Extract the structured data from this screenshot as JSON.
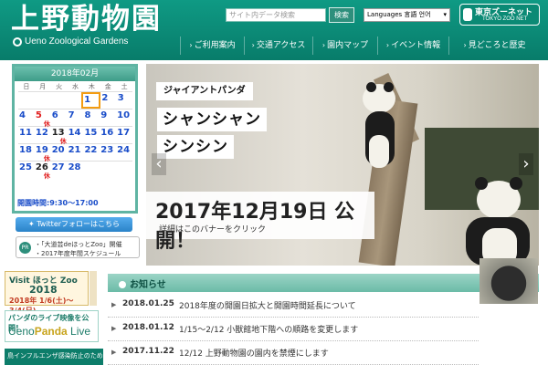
{
  "header": {
    "title": "上野動物園",
    "subtitle": "Ueno Zoological Gardens",
    "search_placeholder": "サイト内データ検索",
    "search_button": "検索",
    "language_label": "Languages 言語 언어",
    "zoonet_jp": "東京ズーネット",
    "zoonet_en": "TOKYO ZOO NET",
    "nav": [
      "ご利用案内",
      "交通アクセス",
      "園内マップ",
      "イベント情報",
      "見どころと歴史"
    ]
  },
  "calendar": {
    "title": "2018年02月",
    "dow": [
      "日",
      "月",
      "火",
      "水",
      "木",
      "金",
      "土"
    ],
    "weeks": [
      [
        "",
        "",
        "",
        "",
        "1",
        "2",
        "3"
      ],
      [
        "4",
        "5",
        "6",
        "7",
        "8",
        "9",
        "10"
      ],
      [
        "11",
        "12",
        "13",
        "14",
        "15",
        "16",
        "17"
      ],
      [
        "18",
        "19",
        "20",
        "21",
        "22",
        "23",
        "24"
      ],
      [
        "25",
        "26",
        "27",
        "28",
        "",
        "",
        ""
      ]
    ],
    "closed_label": "休",
    "hours": "開園時間:9:30〜17:00"
  },
  "sidebar": {
    "twitter_label": "Twitterフォローはこちら",
    "pr_badge": "PR",
    "pr_lines": [
      "・「大道芸deほっとZoo」開催",
      "・2017年度年間スケジュール"
    ],
    "hotzoo_t1": "Visit ほっと Zoo",
    "hotzoo_t2": "2018",
    "hotzoo_t3": "2018年 1/6(土)〜3/4(日)",
    "panda_live_t1": "パンダのライブ映像を公開!",
    "panda_live_t2a": "Ueno",
    "panda_live_t2b": "Panda",
    "panda_live_t2c": " Live",
    "bird_flu": "鳥インフルエンザ感染防止のため"
  },
  "hero": {
    "tag": "ジャイアントパンダ",
    "title1": "シャンシャン",
    "title2": "シンシン",
    "date": "2017年12月19日 公開！",
    "cta": "詳細はこのバナーをクリック",
    "prev": "‹",
    "next": "›"
  },
  "news": {
    "heading": "お知らせ",
    "items": [
      {
        "date": "2018.01.25",
        "text": "2018年度の開園日拡大と開園時間延長について"
      },
      {
        "date": "2018.01.12",
        "text": "1/15〜2/12 小獣館地下階への順路を変更します"
      },
      {
        "date": "2017.11.22",
        "text": "12/12 上野動物園の園内を禁煙にします"
      }
    ]
  },
  "colors": {
    "brand": "#0b8a75",
    "closed": "#e02020",
    "weekday": "#1a4dc9"
  }
}
